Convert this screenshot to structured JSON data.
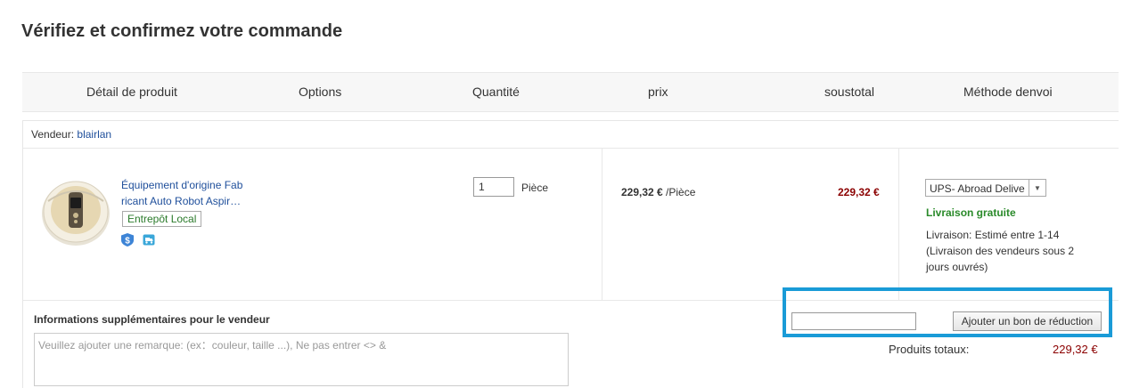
{
  "page": {
    "title": "Vérifiez et confirmez votre commande"
  },
  "columns": {
    "product": "Détail de produit",
    "options": "Options",
    "quantity": "Quantité",
    "price": "prix",
    "subtotal": "soustotal",
    "shipping": "Méthode denvoi"
  },
  "seller": {
    "label": "Vendeur:",
    "name": "blairlan"
  },
  "item": {
    "name_line1": "Équipement d'origine Fab",
    "name_line2": "ricant Auto Robot Aspir…",
    "warehouse_tag": "Entrepôt Local",
    "badges": [
      "dollar-shield-icon",
      "shipping-tag-icon"
    ],
    "quantity": "1",
    "unit": "Pièce",
    "price": "229,32 €",
    "price_unit": " /Pièce",
    "subtotal": "229,32 €"
  },
  "shipping": {
    "method": "UPS- Abroad Delive",
    "free_label": "Livraison gratuite",
    "estimate": "Livraison: Estimé entre 1-14",
    "note_line1": "(Livraison des vendeurs sous 2",
    "note_line2": "jours ouvrés)"
  },
  "notes": {
    "label": "Informations supplémentaires pour le vendeur",
    "placeholder": "Veuillez ajouter une remarque: (ex：couleur, taille ...), Ne pas entrer <> &"
  },
  "coupon": {
    "value": "",
    "button": "Ajouter un bon de réduction"
  },
  "totals": {
    "products_label": "Produits totaux:",
    "products_value": "229,32 €"
  },
  "colors": {
    "highlight": "#1a9bd7",
    "price_red": "#8b0000",
    "link_blue": "#1f4f9b",
    "free_green": "#2a8a2a"
  }
}
